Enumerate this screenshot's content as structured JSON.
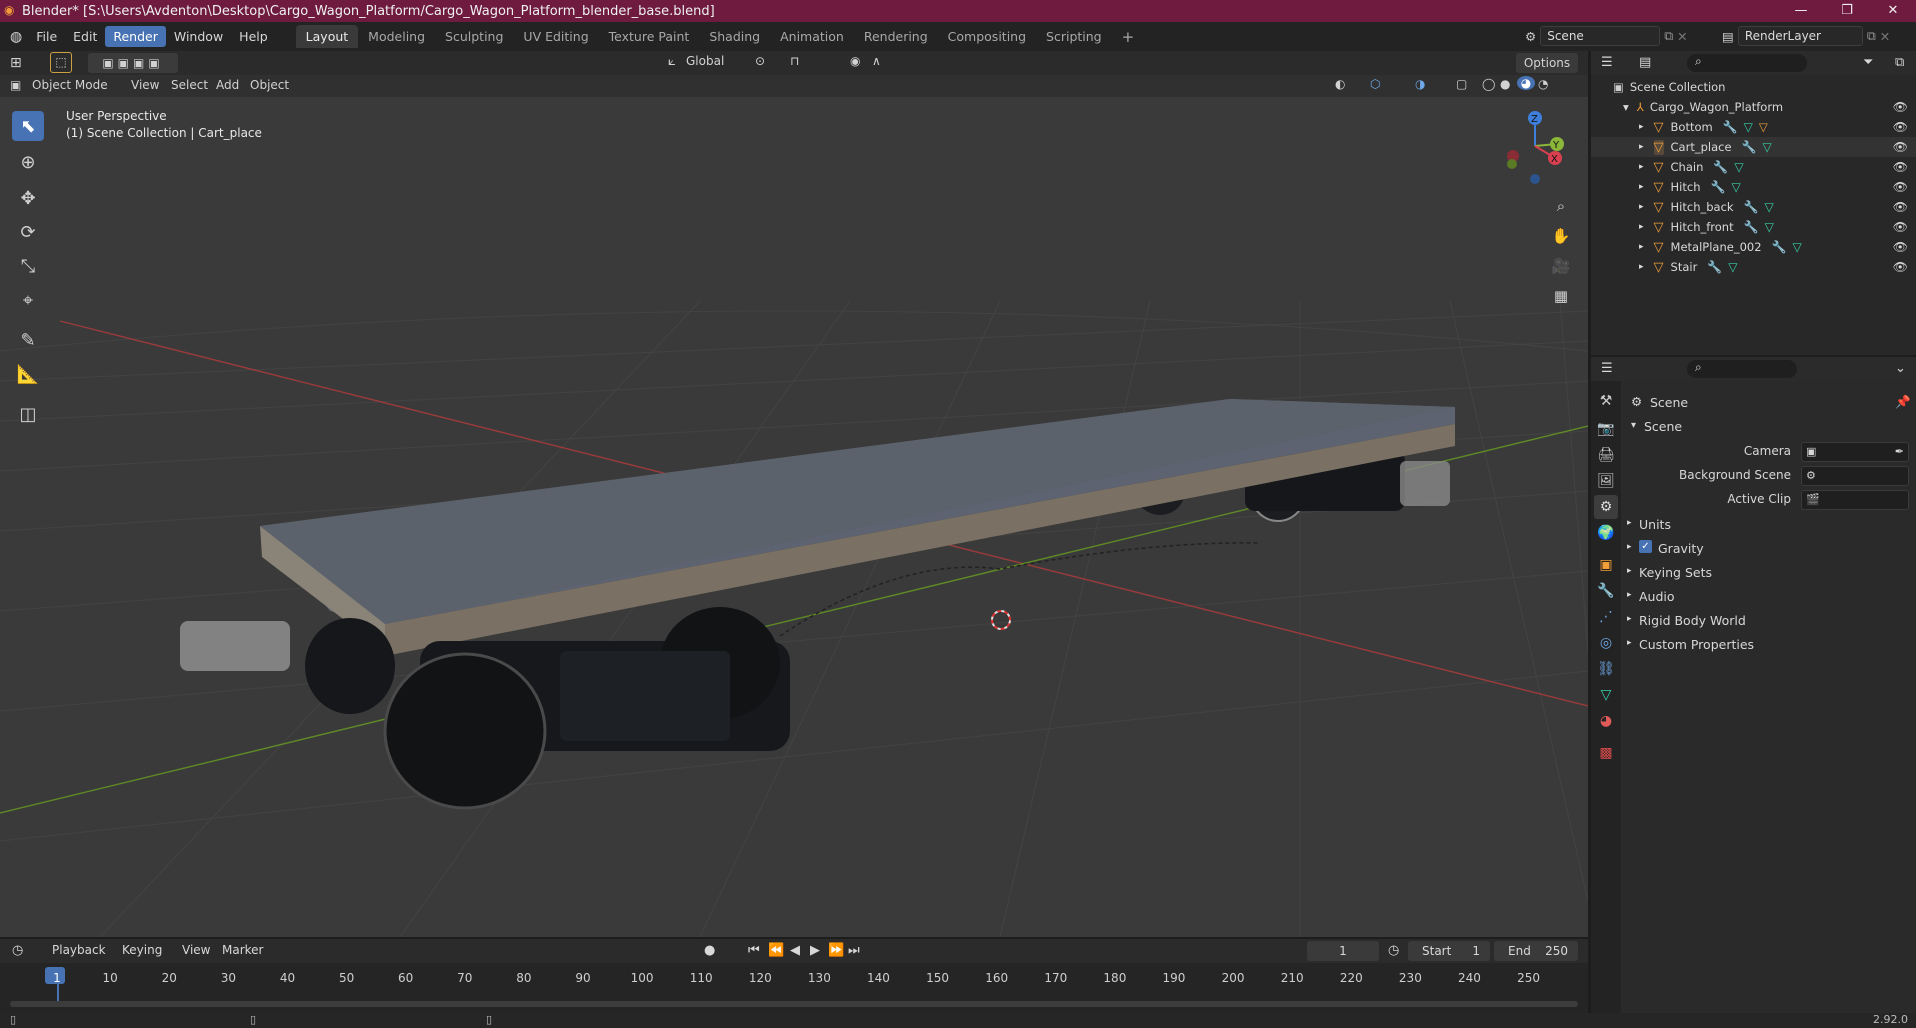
{
  "title": "Blender* [S:\\Users\\Avdenton\\Desktop\\Cargo_Wagon_Platform/Cargo_Wagon_Platform_blender_base.blend]",
  "window_buttons": [
    "—",
    "❐",
    "✕"
  ],
  "menu": [
    "File",
    "Edit",
    "Render",
    "Window",
    "Help"
  ],
  "workspaces": [
    "Layout",
    "Modeling",
    "Sculpting",
    "UV Editing",
    "Texture Paint",
    "Shading",
    "Animation",
    "Rendering",
    "Compositing",
    "Scripting"
  ],
  "active_workspace": "Layout",
  "scene_field": "Scene",
  "renderlayer_field": "RenderLayer",
  "viewport": {
    "mode": "Object Mode",
    "menus": [
      "View",
      "Select",
      "Add",
      "Object"
    ],
    "transform_orientation": "Global",
    "options": "Options",
    "overlay_line1": "User Perspective",
    "overlay_line2": "(1) Scene Collection | Cart_place",
    "axis_labels": {
      "z": "Z",
      "y": "Y",
      "x": "X"
    }
  },
  "outliner": {
    "root": "Scene Collection",
    "collection": "Cargo_Wagon_Platform",
    "objects": [
      "Bottom",
      "Cart_place",
      "Chain",
      "Hitch",
      "Hitch_back",
      "Hitch_front",
      "MetalPlane_002",
      "Stair"
    ]
  },
  "properties": {
    "header": "Scene",
    "panel": "Scene",
    "fields": [
      {
        "label": "Camera",
        "value": ""
      },
      {
        "label": "Background Scene",
        "value": ""
      },
      {
        "label": "Active Clip",
        "value": ""
      }
    ],
    "sections": [
      "Units",
      "Gravity",
      "Keying Sets",
      "Audio",
      "Rigid Body World",
      "Custom Properties"
    ],
    "gravity_checked": true
  },
  "timeline": {
    "menus": [
      "Playback",
      "Keying",
      "View",
      "Marker"
    ],
    "current_frame": "1",
    "start_label": "Start",
    "start_value": "1",
    "end_label": "End",
    "end_value": "250",
    "ticks": [
      "1",
      "10",
      "20",
      "30",
      "40",
      "50",
      "60",
      "70",
      "80",
      "90",
      "100",
      "110",
      "120",
      "130",
      "140",
      "150",
      "160",
      "170",
      "180",
      "190",
      "200",
      "210",
      "220",
      "230",
      "240",
      "250"
    ]
  },
  "version": "2.92.0",
  "colors": {
    "accent": "#4772b3",
    "title_bar": "#6e1b3f",
    "object_icon": "#f29e38",
    "x_axis": "#b43a3a",
    "y_axis": "#6a9a2a"
  }
}
